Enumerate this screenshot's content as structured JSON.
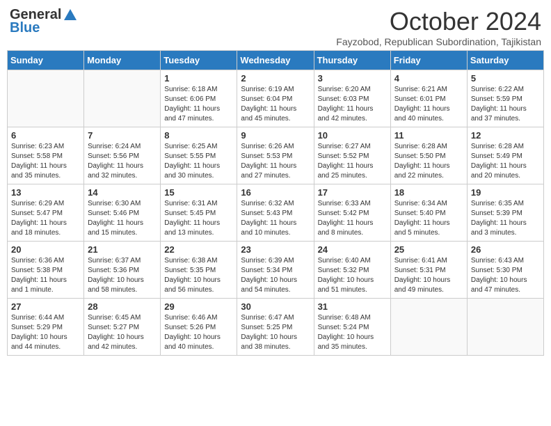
{
  "header": {
    "logo_general": "General",
    "logo_blue": "Blue",
    "month_title": "October 2024",
    "subtitle": "Fayzobod, Republican Subordination, Tajikistan"
  },
  "days_of_week": [
    "Sunday",
    "Monday",
    "Tuesday",
    "Wednesday",
    "Thursday",
    "Friday",
    "Saturday"
  ],
  "weeks": [
    [
      {
        "day": "",
        "info": ""
      },
      {
        "day": "",
        "info": ""
      },
      {
        "day": "1",
        "info": "Sunrise: 6:18 AM\nSunset: 6:06 PM\nDaylight: 11 hours and 47 minutes."
      },
      {
        "day": "2",
        "info": "Sunrise: 6:19 AM\nSunset: 6:04 PM\nDaylight: 11 hours and 45 minutes."
      },
      {
        "day": "3",
        "info": "Sunrise: 6:20 AM\nSunset: 6:03 PM\nDaylight: 11 hours and 42 minutes."
      },
      {
        "day": "4",
        "info": "Sunrise: 6:21 AM\nSunset: 6:01 PM\nDaylight: 11 hours and 40 minutes."
      },
      {
        "day": "5",
        "info": "Sunrise: 6:22 AM\nSunset: 5:59 PM\nDaylight: 11 hours and 37 minutes."
      }
    ],
    [
      {
        "day": "6",
        "info": "Sunrise: 6:23 AM\nSunset: 5:58 PM\nDaylight: 11 hours and 35 minutes."
      },
      {
        "day": "7",
        "info": "Sunrise: 6:24 AM\nSunset: 5:56 PM\nDaylight: 11 hours and 32 minutes."
      },
      {
        "day": "8",
        "info": "Sunrise: 6:25 AM\nSunset: 5:55 PM\nDaylight: 11 hours and 30 minutes."
      },
      {
        "day": "9",
        "info": "Sunrise: 6:26 AM\nSunset: 5:53 PM\nDaylight: 11 hours and 27 minutes."
      },
      {
        "day": "10",
        "info": "Sunrise: 6:27 AM\nSunset: 5:52 PM\nDaylight: 11 hours and 25 minutes."
      },
      {
        "day": "11",
        "info": "Sunrise: 6:28 AM\nSunset: 5:50 PM\nDaylight: 11 hours and 22 minutes."
      },
      {
        "day": "12",
        "info": "Sunrise: 6:28 AM\nSunset: 5:49 PM\nDaylight: 11 hours and 20 minutes."
      }
    ],
    [
      {
        "day": "13",
        "info": "Sunrise: 6:29 AM\nSunset: 5:47 PM\nDaylight: 11 hours and 18 minutes."
      },
      {
        "day": "14",
        "info": "Sunrise: 6:30 AM\nSunset: 5:46 PM\nDaylight: 11 hours and 15 minutes."
      },
      {
        "day": "15",
        "info": "Sunrise: 6:31 AM\nSunset: 5:45 PM\nDaylight: 11 hours and 13 minutes."
      },
      {
        "day": "16",
        "info": "Sunrise: 6:32 AM\nSunset: 5:43 PM\nDaylight: 11 hours and 10 minutes."
      },
      {
        "day": "17",
        "info": "Sunrise: 6:33 AM\nSunset: 5:42 PM\nDaylight: 11 hours and 8 minutes."
      },
      {
        "day": "18",
        "info": "Sunrise: 6:34 AM\nSunset: 5:40 PM\nDaylight: 11 hours and 5 minutes."
      },
      {
        "day": "19",
        "info": "Sunrise: 6:35 AM\nSunset: 5:39 PM\nDaylight: 11 hours and 3 minutes."
      }
    ],
    [
      {
        "day": "20",
        "info": "Sunrise: 6:36 AM\nSunset: 5:38 PM\nDaylight: 11 hours and 1 minute."
      },
      {
        "day": "21",
        "info": "Sunrise: 6:37 AM\nSunset: 5:36 PM\nDaylight: 10 hours and 58 minutes."
      },
      {
        "day": "22",
        "info": "Sunrise: 6:38 AM\nSunset: 5:35 PM\nDaylight: 10 hours and 56 minutes."
      },
      {
        "day": "23",
        "info": "Sunrise: 6:39 AM\nSunset: 5:34 PM\nDaylight: 10 hours and 54 minutes."
      },
      {
        "day": "24",
        "info": "Sunrise: 6:40 AM\nSunset: 5:32 PM\nDaylight: 10 hours and 51 minutes."
      },
      {
        "day": "25",
        "info": "Sunrise: 6:41 AM\nSunset: 5:31 PM\nDaylight: 10 hours and 49 minutes."
      },
      {
        "day": "26",
        "info": "Sunrise: 6:43 AM\nSunset: 5:30 PM\nDaylight: 10 hours and 47 minutes."
      }
    ],
    [
      {
        "day": "27",
        "info": "Sunrise: 6:44 AM\nSunset: 5:29 PM\nDaylight: 10 hours and 44 minutes."
      },
      {
        "day": "28",
        "info": "Sunrise: 6:45 AM\nSunset: 5:27 PM\nDaylight: 10 hours and 42 minutes."
      },
      {
        "day": "29",
        "info": "Sunrise: 6:46 AM\nSunset: 5:26 PM\nDaylight: 10 hours and 40 minutes."
      },
      {
        "day": "30",
        "info": "Sunrise: 6:47 AM\nSunset: 5:25 PM\nDaylight: 10 hours and 38 minutes."
      },
      {
        "day": "31",
        "info": "Sunrise: 6:48 AM\nSunset: 5:24 PM\nDaylight: 10 hours and 35 minutes."
      },
      {
        "day": "",
        "info": ""
      },
      {
        "day": "",
        "info": ""
      }
    ]
  ]
}
